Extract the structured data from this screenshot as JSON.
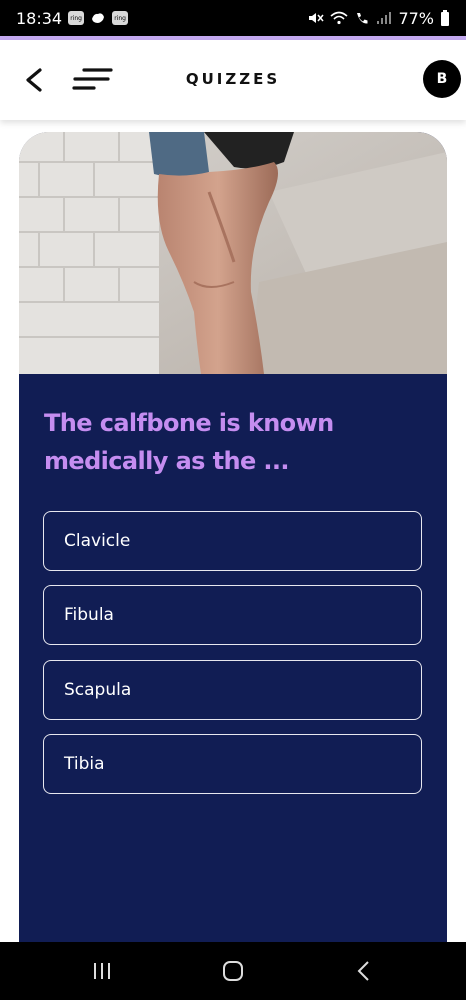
{
  "status_bar": {
    "time": "18:34",
    "notif_badge_1": "ring",
    "notif_badge_2": "ring",
    "battery": "77%"
  },
  "header": {
    "title": "QUIZZES",
    "avatar_initial": "B"
  },
  "quiz": {
    "question": "The calfbone is known medically as the ...",
    "options": [
      {
        "label": "Clavicle"
      },
      {
        "label": "Fibula"
      },
      {
        "label": "Scapula"
      },
      {
        "label": "Tibia"
      }
    ]
  },
  "colors": {
    "card_bg": "#111d54",
    "question_color": "#c58df0",
    "accent_line": "#c3a9f0"
  },
  "icons": [
    "back-arrow-icon",
    "menu-icon",
    "recents-icon",
    "home-icon",
    "android-back-icon"
  ]
}
